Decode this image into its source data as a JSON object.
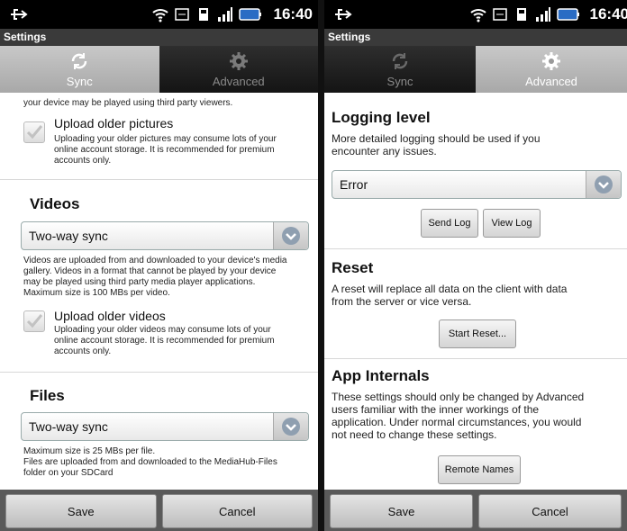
{
  "status": {
    "time": "16:40"
  },
  "left": {
    "title": "Settings",
    "tabs": [
      {
        "label": "Sync",
        "icon": "sync-icon",
        "active": true
      },
      {
        "label": "Advanced",
        "icon": "gear-icon",
        "active": false
      }
    ],
    "partial_text": "your device may be played using third party viewers.",
    "upload_older_pictures": {
      "title": "Upload older pictures",
      "desc_lines": [
        "Uploading your older pictures may consume lots of your",
        "online account storage. It is recommended for premium",
        "accounts only."
      ]
    },
    "videos": {
      "title": "Videos",
      "dropdown_value": "Two-way sync",
      "desc_lines": [
        "Videos are uploaded from and downloaded to your device's media",
        "gallery. Videos in a format that cannot be played by your device",
        "may be played using third party media player applications.",
        "Maximum size is 100 MBs per video."
      ]
    },
    "upload_older_videos": {
      "title": "Upload older videos",
      "desc_lines": [
        "Uploading your older videos may consume lots of your",
        "online account storage. It is recommended for premium",
        "accounts only."
      ]
    },
    "files": {
      "title": "Files",
      "dropdown_value": "Two-way sync",
      "desc_lines": [
        "Maximum size is 25 MBs per file.",
        "Files are uploaded from and downloaded to the MediaHub-Files",
        "folder on your SDCard"
      ]
    },
    "save_label": "Save",
    "cancel_label": "Cancel"
  },
  "right": {
    "title": "Settings",
    "tabs": [
      {
        "label": "Sync",
        "icon": "sync-icon",
        "active": false
      },
      {
        "label": "Advanced",
        "icon": "gear-icon",
        "active": true
      }
    ],
    "logging": {
      "title": "Logging level",
      "desc_lines": [
        "More detailed logging should be used if you",
        "encounter any issues."
      ],
      "dropdown_value": "Error",
      "send_log": "Send Log",
      "view_log": "View Log"
    },
    "reset": {
      "title": "Reset",
      "desc_lines": [
        "A reset will replace all data on the client with data",
        "from the server or vice versa."
      ],
      "button": "Start Reset..."
    },
    "internals": {
      "title": "App Internals",
      "desc_lines": [
        "These settings should only be changed by Advanced",
        "users familiar with the inner workings of the",
        "application. Under normal circumstances, you would",
        "not need to change these settings."
      ],
      "button": "Remote Names"
    },
    "save_label": "Save",
    "cancel_label": "Cancel"
  }
}
